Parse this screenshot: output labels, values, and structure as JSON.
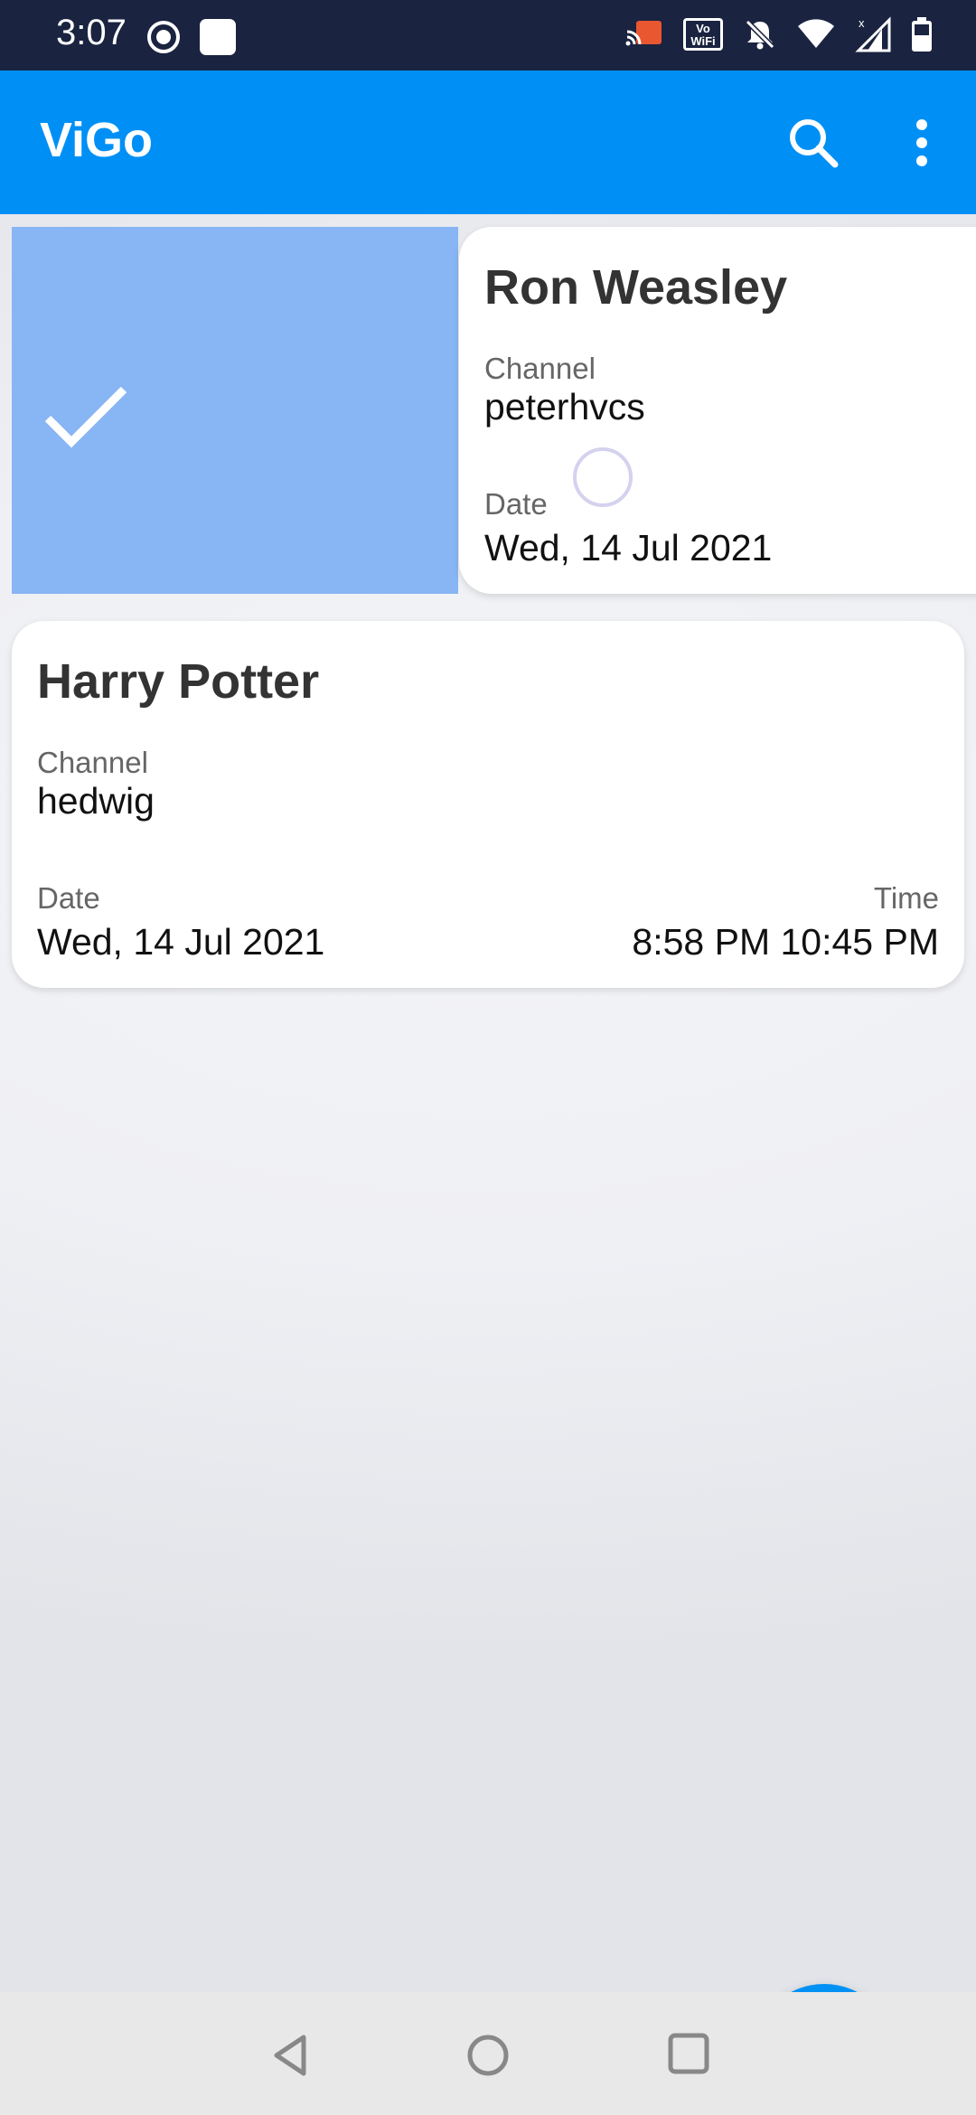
{
  "status_bar": {
    "time": "3:07",
    "vowifi_label": "Vo WiFi",
    "left_icons": [
      "record-icon",
      "app-square-icon"
    ],
    "right_icons": [
      "cast-icon",
      "vowifi-icon",
      "bell-off-icon",
      "wifi-icon",
      "signal-icon",
      "battery-icon"
    ]
  },
  "app_bar": {
    "title": "ViGo",
    "search_icon": "search-icon",
    "menu_icon": "more-vert-icon",
    "color": "#0090f5"
  },
  "cards": [
    {
      "name": "Ron Weasley",
      "channel_label": "Channel",
      "channel": "peterhvcs",
      "date_label": "Date",
      "date": "Wed, 14 Jul 2021",
      "swiped": true,
      "swipe_icon": "check-icon"
    },
    {
      "name": "Harry Potter",
      "channel_label": "Channel",
      "channel": "hedwig",
      "date_label": "Date",
      "date": "Wed, 14 Jul 2021",
      "time_label": "Time",
      "time": "8:58 PM 10:45 PM"
    }
  ],
  "fab": {
    "icon": "plus-icon",
    "color": "#0091f5"
  },
  "nav_bar": {
    "icons": [
      "back-icon",
      "home-icon",
      "recents-icon"
    ]
  }
}
